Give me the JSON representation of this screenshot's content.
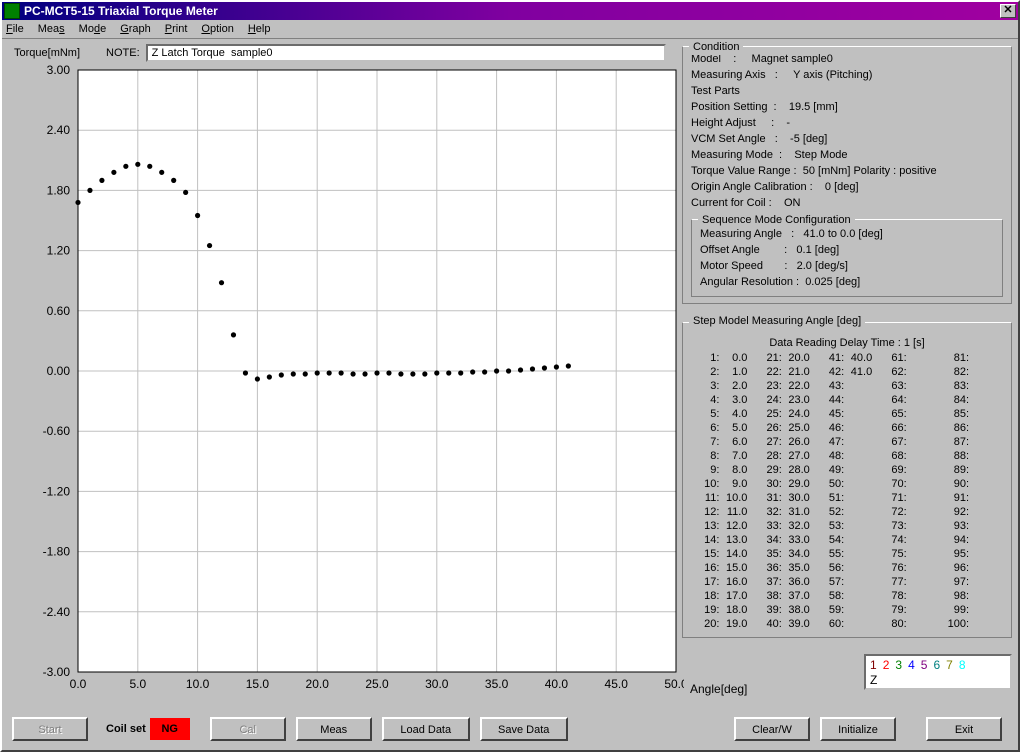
{
  "window": {
    "title": "PC-MCT5-15  Triaxial Torque Meter"
  },
  "menu": {
    "file": "File",
    "meas": "Meas",
    "mode": "Mode",
    "graph": "Graph",
    "print": "Print",
    "option": "Option",
    "help": "Help"
  },
  "labels": {
    "torque": "Torque[mNm]",
    "note": "NOTE:",
    "note_value": "Z Latch Torque  sample0",
    "angle_axis": "Angle[deg]"
  },
  "condition": {
    "title": "Condition",
    "model_lbl": "Model",
    "model_val": "Magnet sample0",
    "axis_lbl": "Measuring Axis",
    "axis_val": "Y axis (Pitching)",
    "testparts_lbl": "Test Parts",
    "position_lbl": "Position Setting",
    "position_val": "19.5  [mm]",
    "height_lbl": "Height Adjust",
    "height_val": "-",
    "vcm_lbl": "VCM Set Angle",
    "vcm_val": "-5  [deg]",
    "measmode_lbl": "Measuring Mode",
    "measmode_val": "Step Mode",
    "range_lbl": "Torque Value Range :",
    "range_val": "50  [mNm]   Polarity :  positive",
    "origin_lbl": "Origin Angle Calibration :",
    "origin_val": "0  [deg]",
    "coil_lbl": "Current for Coil   :",
    "coil_val": "ON"
  },
  "sequence": {
    "title": "Sequence Mode Configuration",
    "angle_lbl": "Measuring Angle",
    "angle_val": "41.0   to   0.0  [deg]",
    "offset_lbl": "Offset Angle",
    "offset_val": "0.1   [deg]",
    "speed_lbl": "Motor Speed",
    "speed_val": "2.0  [deg/s]",
    "res_lbl": "Angular Resolution :",
    "res_val": "0.025  [deg]"
  },
  "step": {
    "title": "Step Model Measuring Angle  [deg]",
    "delay_lbl": "Data Reading Delay Time :  1  [s]",
    "angles": [
      "0.0",
      "1.0",
      "2.0",
      "3.0",
      "4.0",
      "5.0",
      "6.0",
      "7.0",
      "8.0",
      "9.0",
      "10.0",
      "11.0",
      "12.0",
      "13.0",
      "14.0",
      "15.0",
      "16.0",
      "17.0",
      "18.0",
      "19.0",
      "20.0",
      "21.0",
      "22.0",
      "23.0",
      "24.0",
      "25.0",
      "26.0",
      "27.0",
      "28.0",
      "29.0",
      "30.0",
      "31.0",
      "32.0",
      "33.0",
      "34.0",
      "35.0",
      "36.0",
      "37.0",
      "38.0",
      "39.0",
      "40.0",
      "41.0"
    ],
    "max_slots": 100
  },
  "legend": {
    "nums": [
      "1",
      "2",
      "3",
      "4",
      "5",
      "6",
      "7",
      "8"
    ],
    "colors": [
      "#800000",
      "#ff0000",
      "#008000",
      "#0000ff",
      "#800080",
      "#008080",
      "#808000",
      "#00ffff"
    ],
    "letter": "Z"
  },
  "buttons": {
    "start": "Start",
    "coilset": "Coil set",
    "ng": "NG",
    "cal": "Cal",
    "meas": "Meas",
    "load": "Load Data",
    "save": "Save Data",
    "clearw": "Clear/W",
    "init": "Initialize",
    "exit": "Exit"
  },
  "chart_data": {
    "type": "scatter",
    "title": "",
    "xlabel": "Angle[deg]",
    "ylabel": "Torque[mNm]",
    "xlim": [
      0.0,
      50.0
    ],
    "ylim": [
      -3.0,
      3.0
    ],
    "xticks": [
      0.0,
      5.0,
      10.0,
      15.0,
      20.0,
      25.0,
      30.0,
      35.0,
      40.0,
      45.0,
      50.0
    ],
    "yticks": [
      -3.0,
      -2.4,
      -1.8,
      -1.2,
      -0.6,
      0.0,
      0.6,
      1.2,
      1.8,
      2.4,
      3.0
    ],
    "series": [
      {
        "name": "Z",
        "x": [
          0,
          1,
          2,
          3,
          4,
          5,
          6,
          7,
          8,
          9,
          10,
          11,
          12,
          13,
          14,
          15,
          16,
          17,
          18,
          19,
          20,
          21,
          22,
          23,
          24,
          25,
          26,
          27,
          28,
          29,
          30,
          31,
          32,
          33,
          34,
          35,
          36,
          37,
          38,
          39,
          40,
          41
        ],
        "y": [
          1.68,
          1.8,
          1.9,
          1.98,
          2.04,
          2.06,
          2.04,
          1.98,
          1.9,
          1.78,
          1.55,
          1.25,
          0.88,
          0.36,
          -0.02,
          -0.08,
          -0.06,
          -0.04,
          -0.03,
          -0.03,
          -0.02,
          -0.02,
          -0.02,
          -0.03,
          -0.03,
          -0.02,
          -0.02,
          -0.03,
          -0.03,
          -0.03,
          -0.02,
          -0.02,
          -0.02,
          -0.01,
          -0.01,
          0.0,
          0.0,
          0.01,
          0.02,
          0.03,
          0.04,
          0.05
        ]
      }
    ]
  }
}
